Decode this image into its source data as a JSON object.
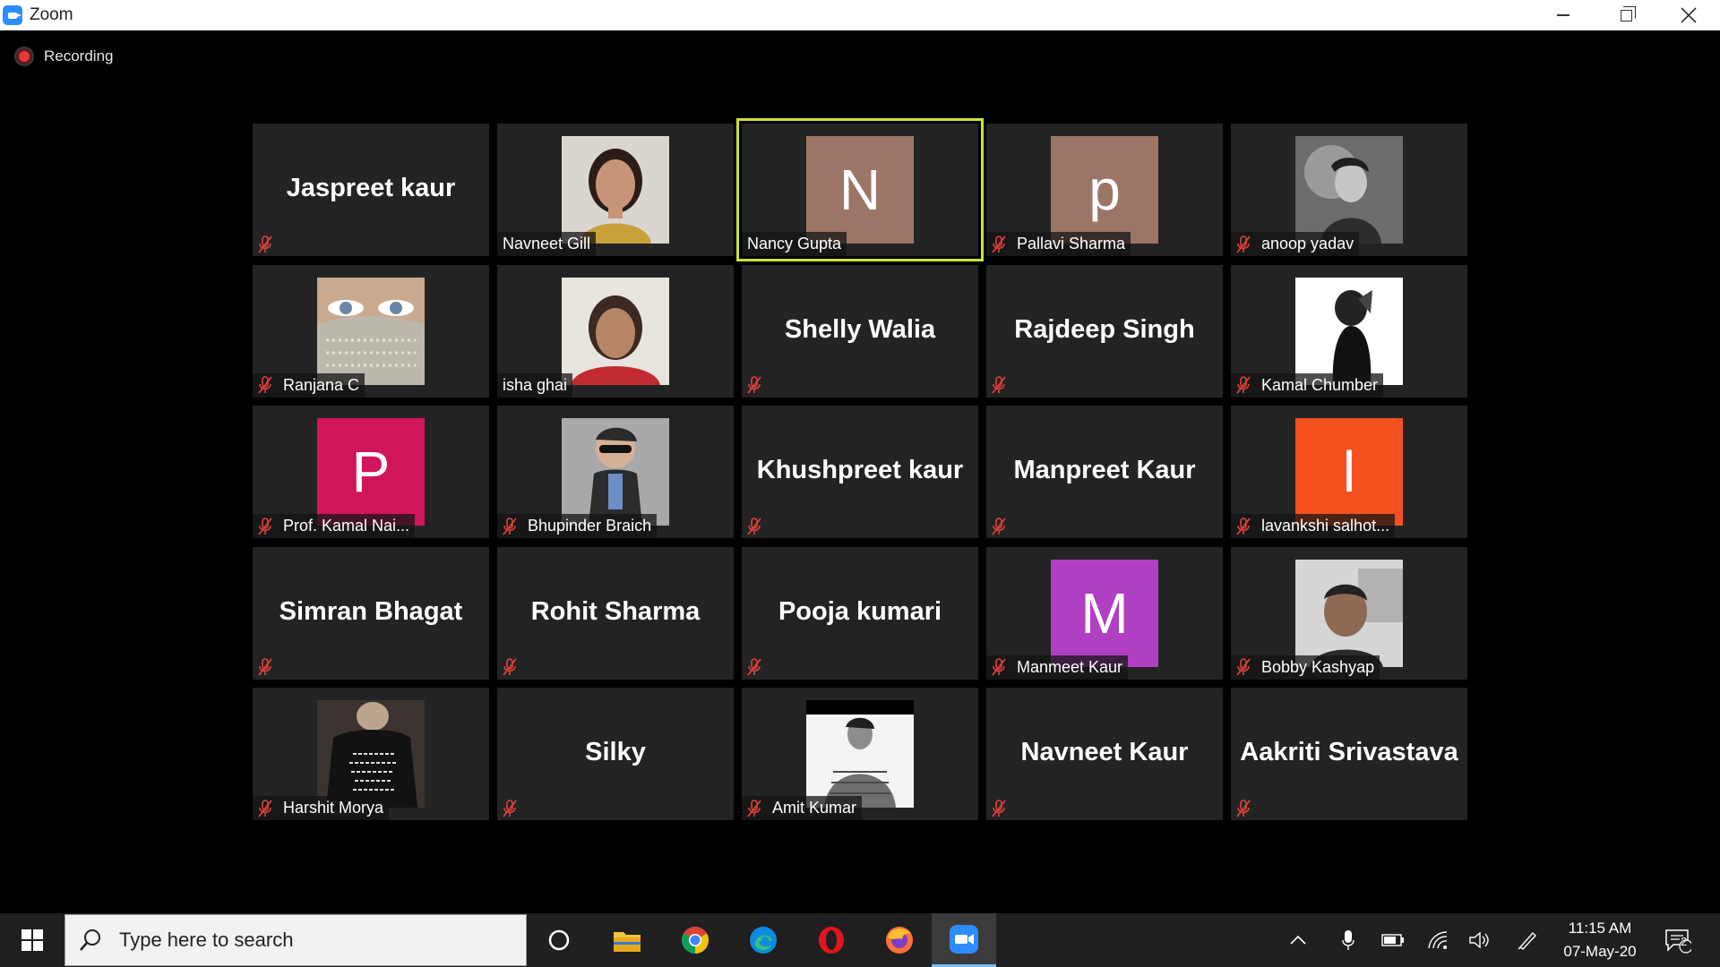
{
  "window": {
    "title": "Zoom"
  },
  "recording": {
    "label": "Recording"
  },
  "participants": [
    {
      "name": "Jaspreet kaur",
      "kind": "name",
      "muted": true
    },
    {
      "name": "Navneet Gill",
      "kind": "photo",
      "photo": "woman-portrait",
      "muted": false
    },
    {
      "name": "Nancy Gupta",
      "kind": "letter",
      "letter": "N",
      "color": "#9b7565",
      "muted": false,
      "active_speaker": true
    },
    {
      "name": "Pallavi Sharma",
      "kind": "letter",
      "letter": "p",
      "color": "#9b7565",
      "muted": true
    },
    {
      "name": "anoop yadav",
      "kind": "photo",
      "photo": "man-bw",
      "muted": true
    },
    {
      "name": "Ranjana C",
      "kind": "photo",
      "photo": "eyes-closeup",
      "muted": true
    },
    {
      "name": "isha ghai",
      "kind": "photo",
      "photo": "woman-selfie",
      "muted": false
    },
    {
      "name": "Shelly Walia",
      "kind": "name",
      "muted": true
    },
    {
      "name": "Rajdeep Singh",
      "kind": "name",
      "muted": true
    },
    {
      "name": "Kamal Chumber",
      "kind": "photo",
      "photo": "sketch-girl",
      "muted": true
    },
    {
      "name": "Prof. Kamal Nai...",
      "kind": "letter",
      "letter": "P",
      "color": "#d0155b",
      "muted": true
    },
    {
      "name": "Bhupinder Braich",
      "kind": "photo",
      "photo": "child",
      "muted": true
    },
    {
      "name": "Khushpreet kaur",
      "kind": "name",
      "muted": true
    },
    {
      "name": "Manpreet Kaur",
      "kind": "name",
      "muted": true
    },
    {
      "name": "lavankshi salhot...",
      "kind": "letter",
      "letter": "l",
      "color": "#f4511e",
      "muted": true
    },
    {
      "name": "Simran Bhagat",
      "kind": "name",
      "muted": true
    },
    {
      "name": "Rohit Sharma",
      "kind": "name",
      "muted": true
    },
    {
      "name": "Pooja kumari",
      "kind": "name",
      "muted": true
    },
    {
      "name": "Manmeet Kaur",
      "kind": "letter",
      "letter": "M",
      "color": "#b03fc4",
      "muted": true
    },
    {
      "name": "Bobby Kashyap",
      "kind": "photo",
      "photo": "man-selfie",
      "muted": true
    },
    {
      "name": "Harshit Morya",
      "kind": "photo",
      "photo": "quote-shirt",
      "muted": true
    },
    {
      "name": "Silky",
      "kind": "name",
      "muted": true
    },
    {
      "name": "Amit Kumar",
      "kind": "photo",
      "photo": "man-bw-standing",
      "muted": true
    },
    {
      "name": "Navneet Kaur",
      "kind": "name",
      "muted": true
    },
    {
      "name": "Aakriti Srivastava",
      "kind": "name",
      "muted": true
    }
  ],
  "taskbar": {
    "search_placeholder": "Type here to search",
    "apps": [
      "cortana-icon",
      "file-explorer-icon",
      "chrome-icon",
      "edge-icon",
      "opera-icon",
      "firefox-icon",
      "zoom-icon"
    ],
    "time": "11:15 AM",
    "date": "07-May-20",
    "notification_count": "2"
  }
}
